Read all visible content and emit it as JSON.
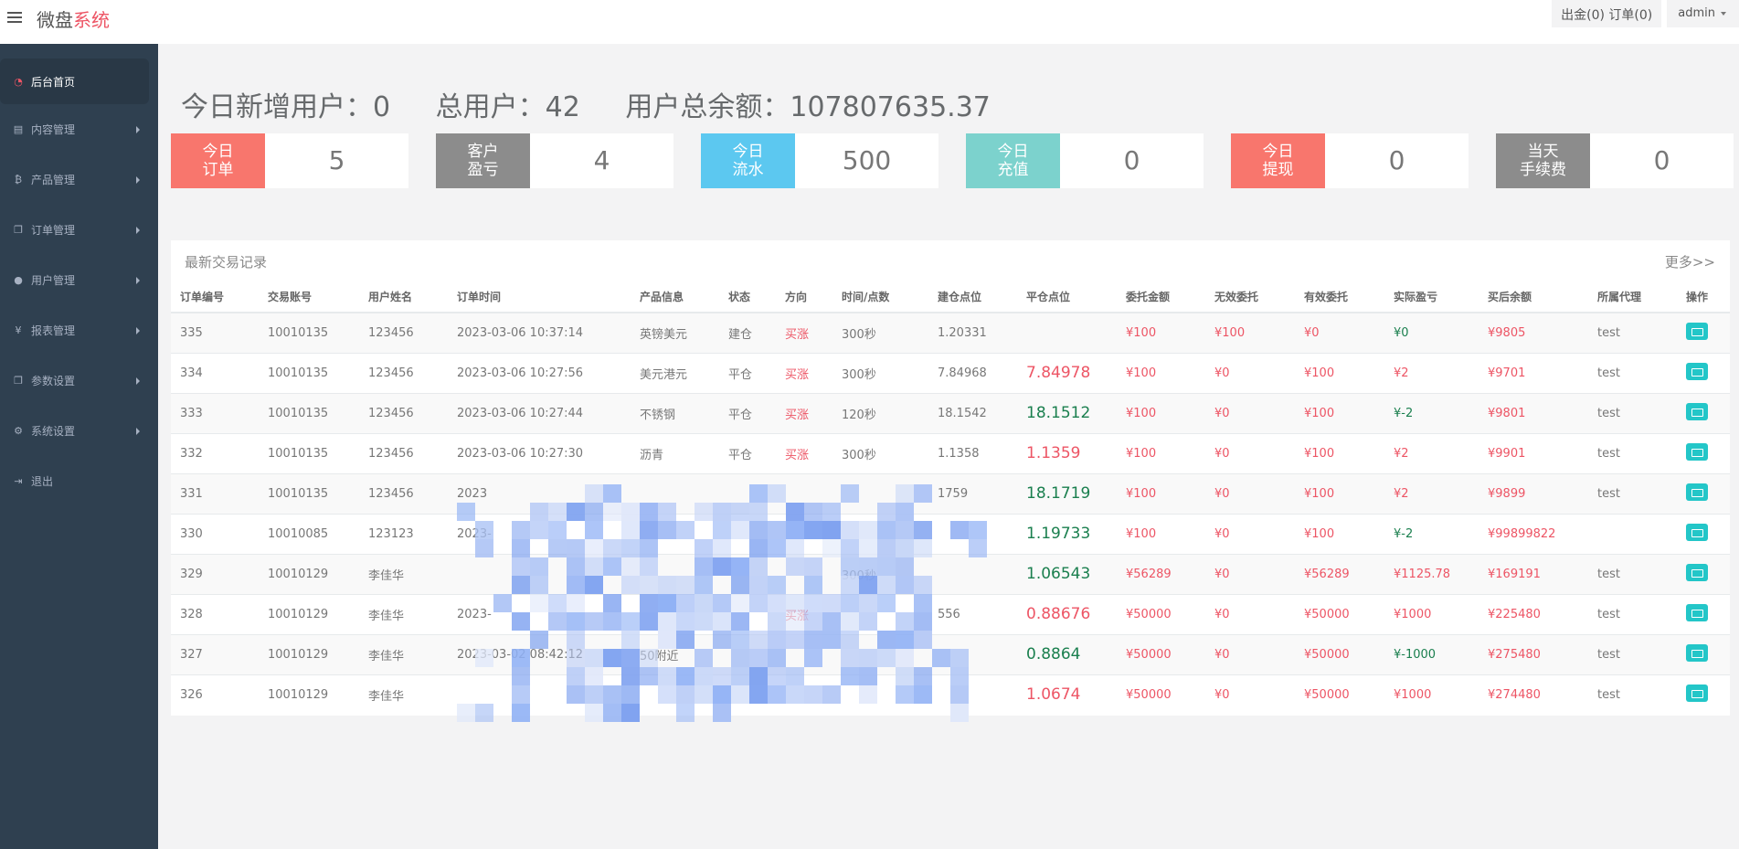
{
  "header": {
    "brand_main": "微盘",
    "brand_accent": "系统",
    "links": "出金(0) 订单(0)",
    "user": "admin"
  },
  "sidebar": {
    "items": [
      {
        "label": "后台首页",
        "icon": "dashboard-icon"
      },
      {
        "label": "内容管理",
        "icon": "book-icon"
      },
      {
        "label": "产品管理",
        "icon": "bitcoin-icon"
      },
      {
        "label": "订单管理",
        "icon": "copy-icon"
      },
      {
        "label": "用户管理",
        "icon": "user-icon"
      },
      {
        "label": "报表管理",
        "icon": "yen-icon"
      },
      {
        "label": "参数设置",
        "icon": "copy-icon"
      },
      {
        "label": "系统设置",
        "icon": "cogs-icon"
      },
      {
        "label": "退出",
        "icon": "sign-out-icon"
      }
    ]
  },
  "stats": {
    "new_users": "今日新增用户：0",
    "total_users": "总用户：42",
    "total_balance": "用户总余额：107807635.37"
  },
  "cards": [
    {
      "label1": "今日",
      "label2": "订单",
      "value": "5",
      "color": "#f8766d"
    },
    {
      "label1": "客户",
      "label2": "盈亏",
      "value": "4",
      "color": "#8c8c8c"
    },
    {
      "label1": "今日",
      "label2": "流水",
      "value": "500",
      "color": "#5cc8f0"
    },
    {
      "label1": "今日",
      "label2": "充值",
      "value": "0",
      "color": "#7cd2cd"
    },
    {
      "label1": "今日",
      "label2": "提现",
      "value": "0",
      "color": "#f8766d"
    },
    {
      "label1": "当天",
      "label2": "手续费",
      "value": "0",
      "color": "#8c8c8c"
    }
  ],
  "panel": {
    "title": "最新交易记录",
    "more": "更多>>"
  },
  "table": {
    "headers": [
      "订单编号",
      "交易账号",
      "用户姓名",
      "订单时间",
      "产品信息",
      "状态",
      "方向",
      "时间/点数",
      "建仓点位",
      "平仓点位",
      "委托金额",
      "无效委托",
      "有效委托",
      "实际盈亏",
      "买后余额",
      "所属代理",
      "操作"
    ],
    "rows": [
      [
        "335",
        "10010135",
        "123456",
        "2023-03-06 10:37:14",
        "英镑美元",
        "建仓",
        "买涨",
        "300秒",
        "1.20331",
        "",
        "¥100",
        "¥100",
        "¥0",
        "¥0",
        "¥9805",
        "test"
      ],
      [
        "334",
        "10010135",
        "123456",
        "2023-03-06 10:27:56",
        "美元港元",
        "平仓",
        "买涨",
        "300秒",
        "7.84968",
        "7.84978",
        "¥100",
        "¥0",
        "¥100",
        "¥2",
        "¥9701",
        "test"
      ],
      [
        "333",
        "10010135",
        "123456",
        "2023-03-06 10:27:44",
        "不锈钢",
        "平仓",
        "买涨",
        "120秒",
        "18.1542",
        "18.1512",
        "¥100",
        "¥0",
        "¥100",
        "¥-2",
        "¥9801",
        "test"
      ],
      [
        "332",
        "10010135",
        "123456",
        "2023-03-06 10:27:30",
        "沥青",
        "平仓",
        "买涨",
        "300秒",
        "1.1358",
        "1.1359",
        "¥100",
        "¥0",
        "¥100",
        "¥2",
        "¥9901",
        "test"
      ],
      [
        "331",
        "10010135",
        "123456",
        "2023",
        "",
        "",
        "",
        "",
        "1759",
        "18.1719",
        "¥100",
        "¥0",
        "¥100",
        "¥2",
        "¥9899",
        "test"
      ],
      [
        "330",
        "10010085",
        "123123",
        "2023-",
        "",
        "",
        "",
        "",
        "",
        "1.19733",
        "¥100",
        "¥0",
        "¥100",
        "¥-2",
        "¥99899822",
        ""
      ],
      [
        "329",
        "10010129",
        "李佳华",
        "",
        "",
        "",
        "",
        "300秒",
        "",
        "1.06543",
        "¥56289",
        "¥0",
        "¥56289",
        "¥1125.78",
        "¥169191",
        "test"
      ],
      [
        "328",
        "10010129",
        "李佳华",
        "2023-",
        "",
        "",
        "买涨",
        "",
        "556",
        "0.88676",
        "¥50000",
        "¥0",
        "¥50000",
        "¥1000",
        "¥225480",
        "test"
      ],
      [
        "327",
        "10010129",
        "李佳华",
        "2023-03-02 08:42:12",
        "50附近",
        "",
        "",
        "",
        "",
        "0.8864",
        "¥50000",
        "¥0",
        "¥50000",
        "¥-1000",
        "¥275480",
        "test"
      ],
      [
        "326",
        "10010129",
        "李佳华",
        "",
        "",
        "",
        "",
        "",
        "",
        "1.0674",
        "¥50000",
        "¥0",
        "¥50000",
        "¥1000",
        "¥274480",
        "test"
      ]
    ],
    "close_colors": [
      "",
      "red",
      "green",
      "red",
      "green",
      "green",
      "green",
      "red",
      "green",
      "red"
    ],
    "pnl_colors": [
      "green",
      "red",
      "green",
      "red",
      "red",
      "green",
      "red",
      "red",
      "green",
      "red"
    ]
  }
}
